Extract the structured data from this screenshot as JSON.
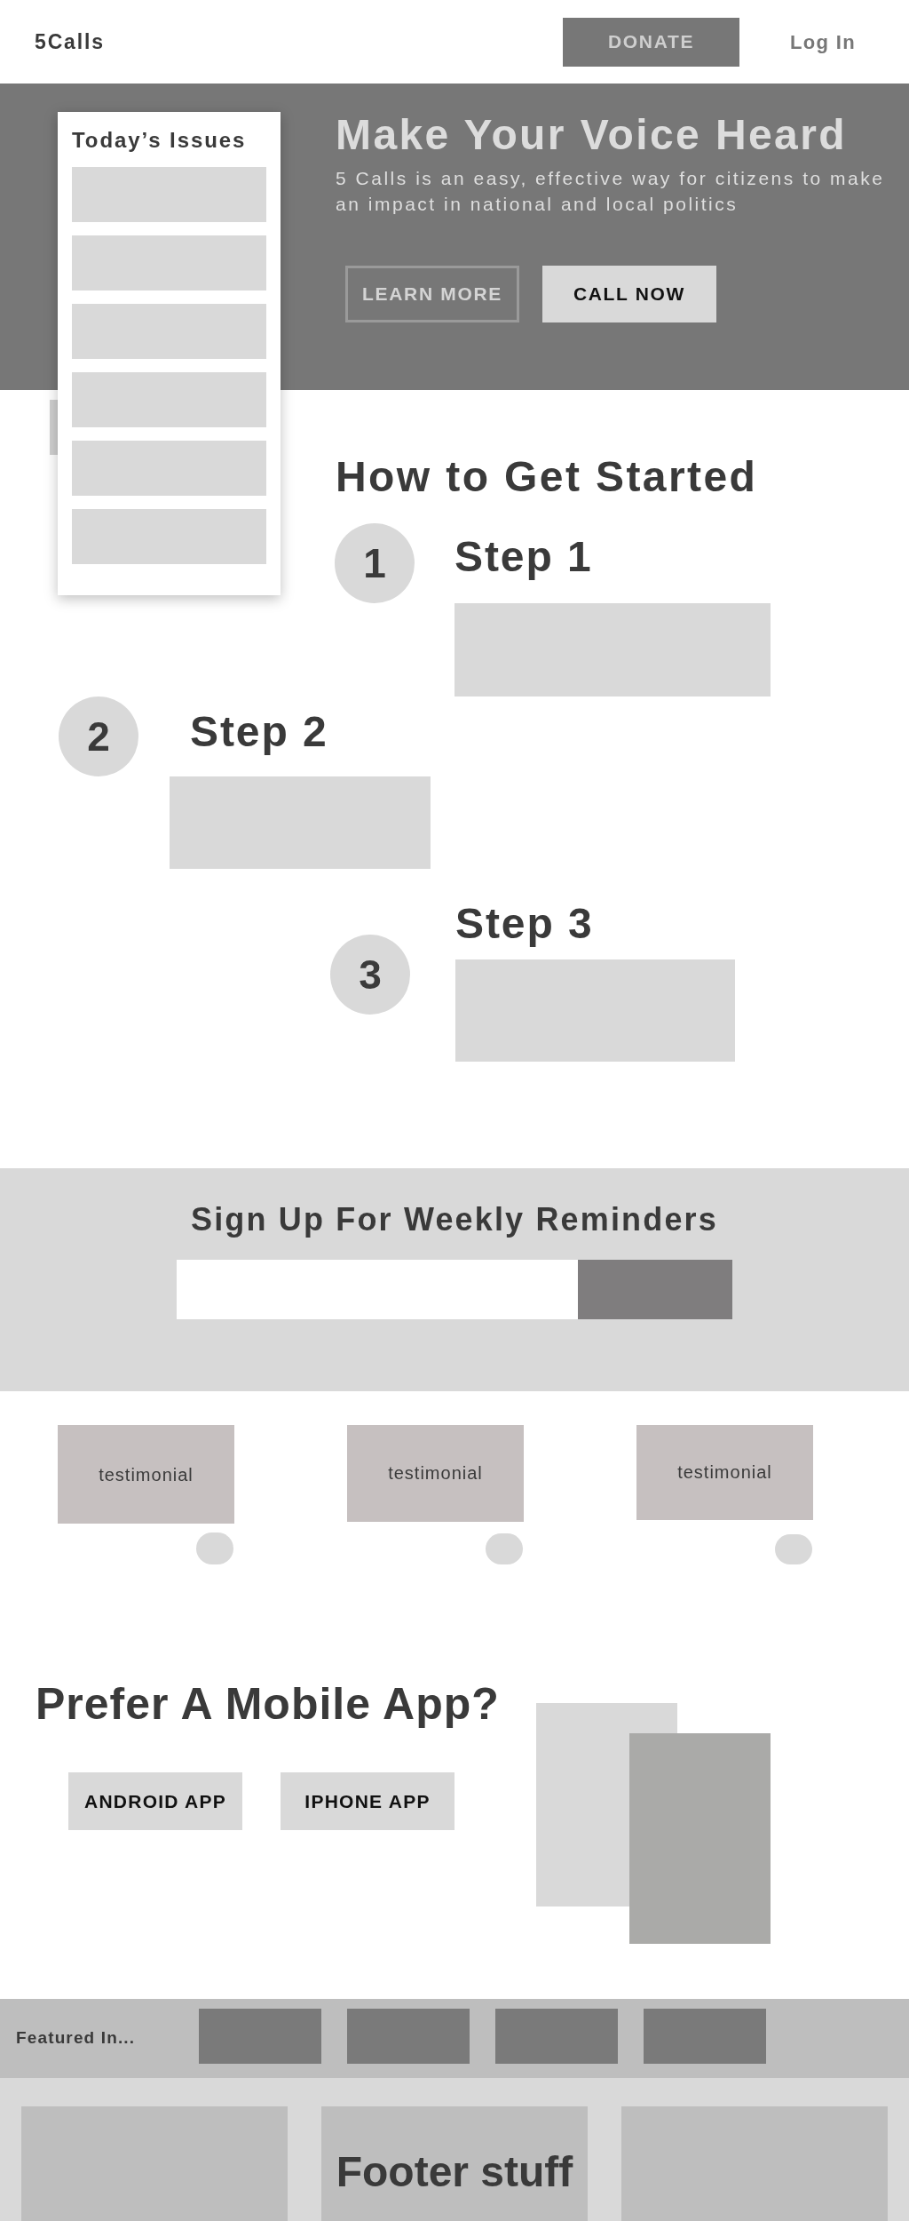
{
  "header": {
    "logo": "5Calls",
    "donate_button": "DONATE",
    "login_link": "Log In"
  },
  "issues_panel": {
    "title": "Today’s Issues"
  },
  "hero": {
    "title": "Make Your Voice Heard",
    "subtitle": "5 Calls is an easy, effective way for citizens to make an impact in national and local politics",
    "buttons": [
      {
        "label": "LEARN MORE",
        "kind": "outline"
      },
      {
        "label": "CALL NOW",
        "kind": "solid"
      }
    ]
  },
  "get_started": {
    "title": "How to Get Started",
    "steps": [
      {
        "number": "1",
        "title": "Step 1"
      },
      {
        "number": "2",
        "title": "Step 2"
      },
      {
        "number": "3",
        "title": "Step 3"
      }
    ]
  },
  "signup": {
    "title": "Sign Up For Weekly Reminders"
  },
  "testimonials": [
    "testimonial",
    "testimonial",
    "testimonial"
  ],
  "mobile_app": {
    "title": "Prefer A Mobile App?",
    "buttons": [
      "ANDROID APP",
      "IPHONE APP"
    ]
  },
  "featured": {
    "label": "Featured In..."
  },
  "footer": {
    "text": "Footer stuff"
  }
}
